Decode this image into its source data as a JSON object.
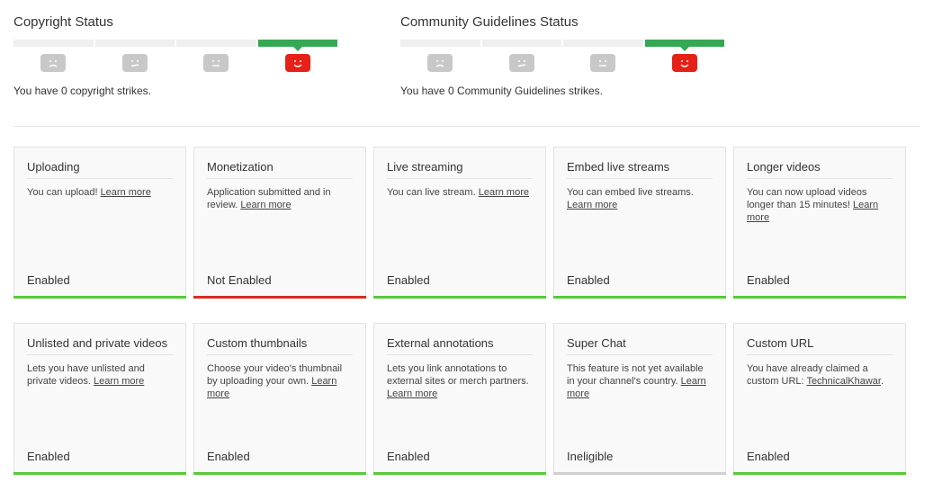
{
  "colors": {
    "enabled": "#57c93a",
    "not_enabled": "#d62b22",
    "ineligible": "#d0d0d0",
    "meter_active": "#34a853",
    "face_active": "#e62117",
    "face_inactive": "#c8c8c8"
  },
  "copyright": {
    "title": "Copyright Status",
    "text": "You have 0 copyright strikes.",
    "faces": [
      "sad-face-icon",
      "meh-face-icon",
      "neutral-face-icon",
      "happy-face-icon"
    ],
    "active_level": 4
  },
  "community": {
    "title": "Community Guidelines Status",
    "text": "You have 0 Community Guidelines strikes.",
    "faces": [
      "sad-face-icon",
      "meh-face-icon",
      "neutral-face-icon",
      "happy-face-icon"
    ],
    "active_level": 4
  },
  "features": [
    {
      "title": "Uploading",
      "desc": "You can upload!",
      "link": "Learn more",
      "status": "Enabled",
      "state": "enabled"
    },
    {
      "title": "Monetization",
      "desc": "Application submitted and in review.",
      "link": "Learn more",
      "status": "Not Enabled",
      "state": "not-enabled"
    },
    {
      "title": "Live streaming",
      "desc": "You can live stream.",
      "link": "Learn more",
      "status": "Enabled",
      "state": "enabled"
    },
    {
      "title": "Embed live streams",
      "desc": "You can embed live streams.",
      "link": "Learn more",
      "status": "Enabled",
      "state": "enabled"
    },
    {
      "title": "Longer videos",
      "desc": "You can now upload videos longer than 15 minutes!",
      "link": "Learn more",
      "status": "Enabled",
      "state": "enabled"
    },
    {
      "title": "Unlisted and private videos",
      "desc": "Lets you have unlisted and private videos.",
      "link": "Learn more",
      "status": "Enabled",
      "state": "enabled"
    },
    {
      "title": "Custom thumbnails",
      "desc": "Choose your video's thumbnail by uploading your own.",
      "link": "Learn more",
      "status": "Enabled",
      "state": "enabled"
    },
    {
      "title": "External annotations",
      "desc": "Lets you link annotations to external sites or merch partners.",
      "link": "Learn more",
      "status": "Enabled",
      "state": "enabled"
    },
    {
      "title": "Super Chat",
      "desc": "This feature is not yet available in your channel's country.",
      "link": "Learn more",
      "status": "Ineligible",
      "state": "ineligible"
    },
    {
      "title": "Custom URL",
      "desc": "You have already claimed a custom URL:",
      "link": "TechnicalKhawar",
      "suffix": ".",
      "status": "Enabled",
      "state": "enabled"
    }
  ]
}
